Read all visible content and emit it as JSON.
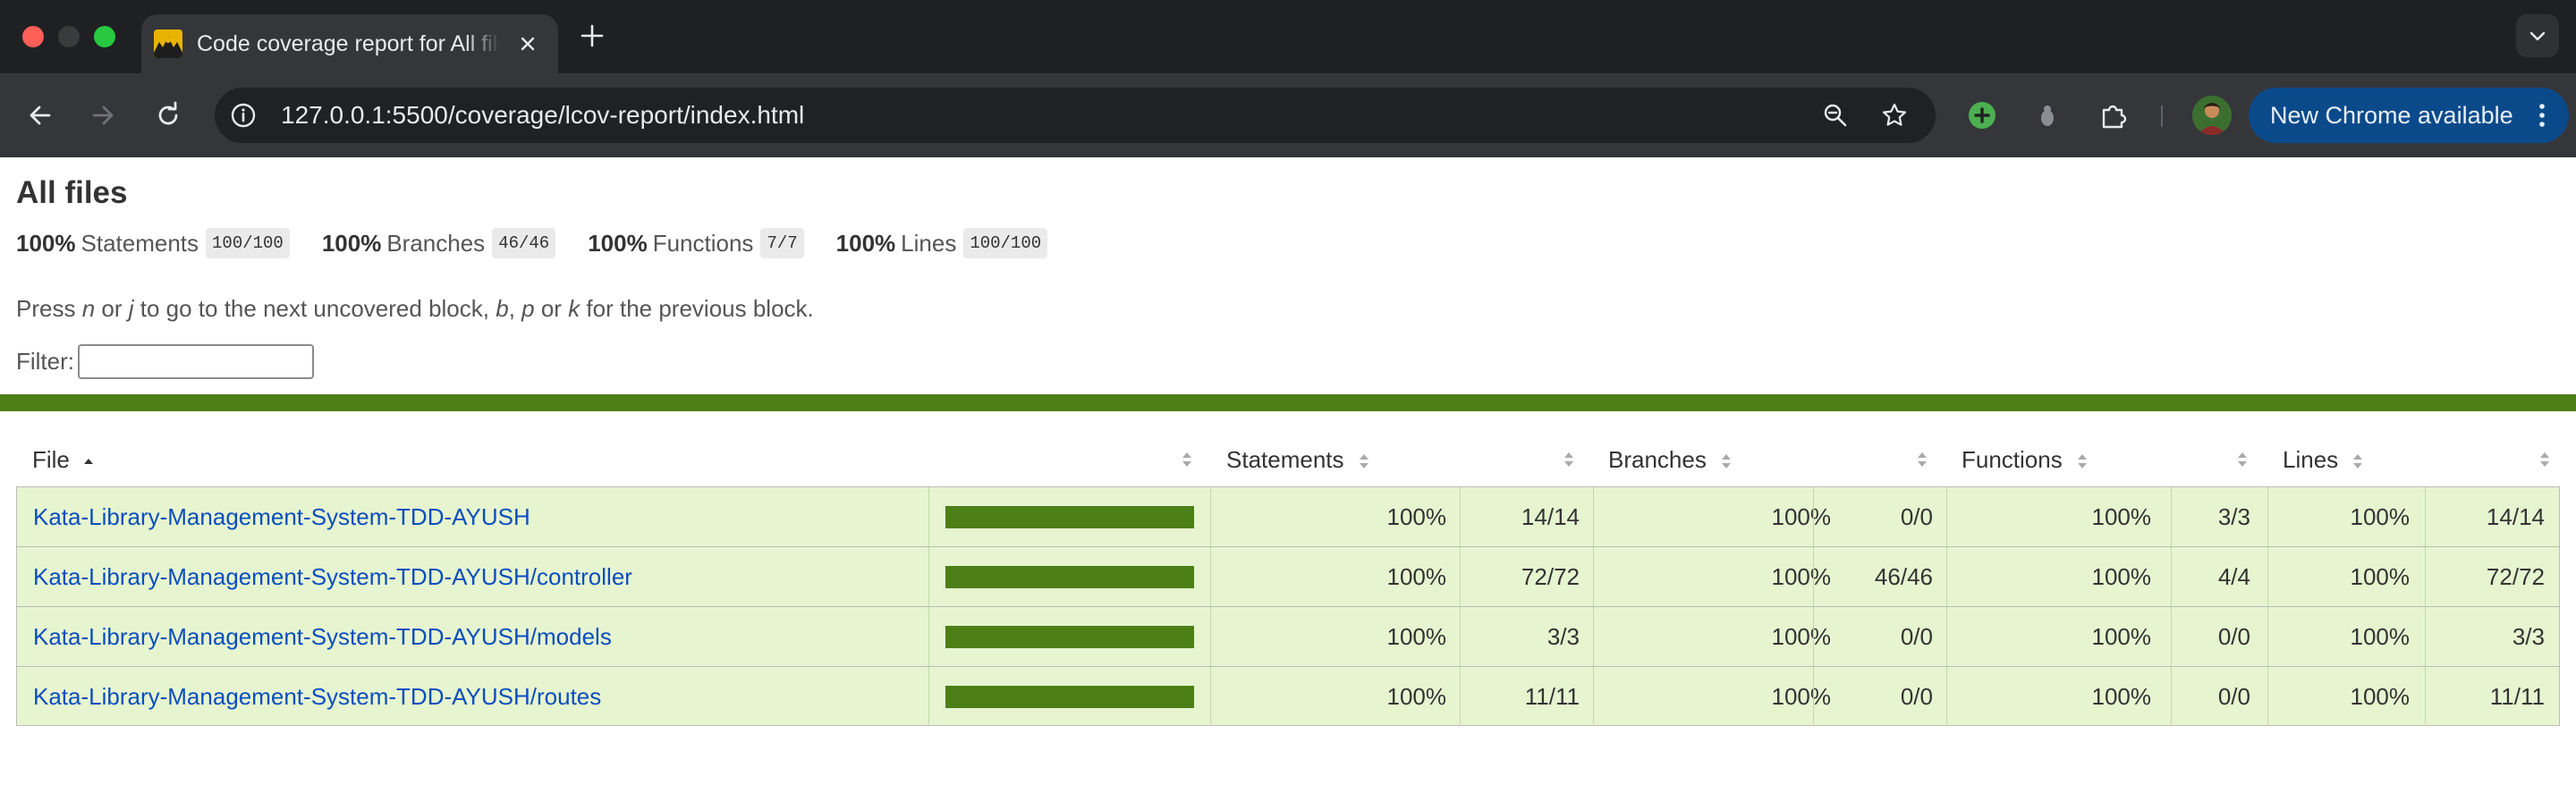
{
  "browser": {
    "tab": {
      "title": "Code coverage report for All files",
      "favicon": "istanbul-favicon"
    },
    "url_host": "127.0.0.1",
    "url_path": ":5500/coverage/lcov-report/index.html",
    "update_label": "New Chrome available",
    "colors": {
      "frame": "#1f2023",
      "toolbar": "#35363a",
      "omnibox": "#202124",
      "update": "#0b4a8a"
    }
  },
  "report": {
    "title": "All files",
    "summary": [
      {
        "pct": "100%",
        "label": "Statements",
        "fraction": "100/100"
      },
      {
        "pct": "100%",
        "label": "Branches",
        "fraction": "46/46"
      },
      {
        "pct": "100%",
        "label": "Functions",
        "fraction": "7/7"
      },
      {
        "pct": "100%",
        "label": "Lines",
        "fraction": "100/100"
      }
    ],
    "hint": {
      "p1": "Press ",
      "k1": "n",
      "p2": " or ",
      "k2": "j",
      "p3": " to go to the next uncovered block, ",
      "k3": "b",
      "p4": ", ",
      "k4": "p",
      "p5": " or ",
      "k5": "k",
      "p6": " for the previous block."
    },
    "filter_label": "Filter:",
    "filter_value": "",
    "columns": {
      "file": "File",
      "statements": "Statements",
      "branches": "Branches",
      "functions": "Functions",
      "lines": "Lines"
    },
    "rows": [
      {
        "file": "Kata-Library-Management-System-TDD-AYUSH",
        "coverage": 1.0,
        "stmt_pct": "100%",
        "stmt_frac": "14/14",
        "br_pct": "100%",
        "br_frac": "0/0",
        "fn_pct": "100%",
        "fn_frac": "3/3",
        "ln_pct": "100%",
        "ln_frac": "14/14"
      },
      {
        "file": "Kata-Library-Management-System-TDD-AYUSH/controller",
        "coverage": 1.0,
        "stmt_pct": "100%",
        "stmt_frac": "72/72",
        "br_pct": "100%",
        "br_frac": "46/46",
        "fn_pct": "100%",
        "fn_frac": "4/4",
        "ln_pct": "100%",
        "ln_frac": "72/72"
      },
      {
        "file": "Kata-Library-Management-System-TDD-AYUSH/models",
        "coverage": 1.0,
        "stmt_pct": "100%",
        "stmt_frac": "3/3",
        "br_pct": "100%",
        "br_frac": "0/0",
        "fn_pct": "100%",
        "fn_frac": "0/0",
        "ln_pct": "100%",
        "ln_frac": "3/3"
      },
      {
        "file": "Kata-Library-Management-System-TDD-AYUSH/routes",
        "coverage": 1.0,
        "stmt_pct": "100%",
        "stmt_frac": "11/11",
        "br_pct": "100%",
        "br_frac": "0/0",
        "fn_pct": "100%",
        "fn_frac": "0/0",
        "ln_pct": "100%",
        "ln_frac": "11/11"
      }
    ],
    "colors": {
      "high_bg": "#e6f5d0",
      "high_bar": "#4d7f17",
      "link": "#0b4ebf"
    }
  }
}
